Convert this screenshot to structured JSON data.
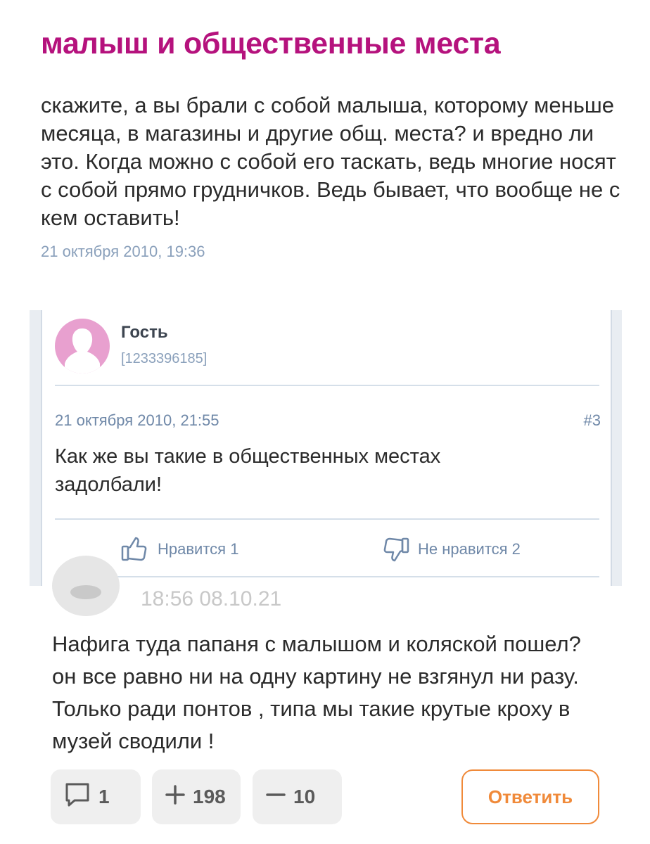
{
  "post": {
    "title": "малыш и общественные места",
    "text": "скажите, а вы брали с собой малыша, которому меньше месяца, в магазины и другие общ. места? и вредно ли это. Когда можно с собой его таскать, ведь многие носят с собой прямо грудничков. Ведь бывает, что вообще не с кем оставить!",
    "date": "21 октября 2010, 19:36"
  },
  "comment": {
    "author": "Гость",
    "author_id": "[1233396185]",
    "date": "21 октября 2010, 21:55",
    "number": "#3",
    "text": "Как же вы такие в общественных местах задолбали!",
    "like_label": "Нравится 1",
    "dislike_label": "Не нравится 2",
    "icons": {
      "avatar": "user-silhouette-icon",
      "like": "thumbs-up-icon",
      "dislike": "thumbs-down-icon"
    }
  },
  "reply": {
    "time": "18:56 08.10.21",
    "text": "Нафига туда папаня с малышом и коляской пошел? он все равно ни на одну картину не взгянул ни разу. Только ради понтов , типа мы такие крутые кроху в музей сводили !",
    "comments_count": "1",
    "plus_count": "198",
    "minus_count": "10",
    "reply_label": "Ответить",
    "icons": {
      "comments": "comment-bubble-icon",
      "plus": "plus-icon",
      "minus": "minus-icon"
    }
  },
  "colors": {
    "title": "#b5127d",
    "meta": "#8aa0bb",
    "accent_orange": "#f08a3a",
    "avatar_pink": "#e8a0cf"
  }
}
